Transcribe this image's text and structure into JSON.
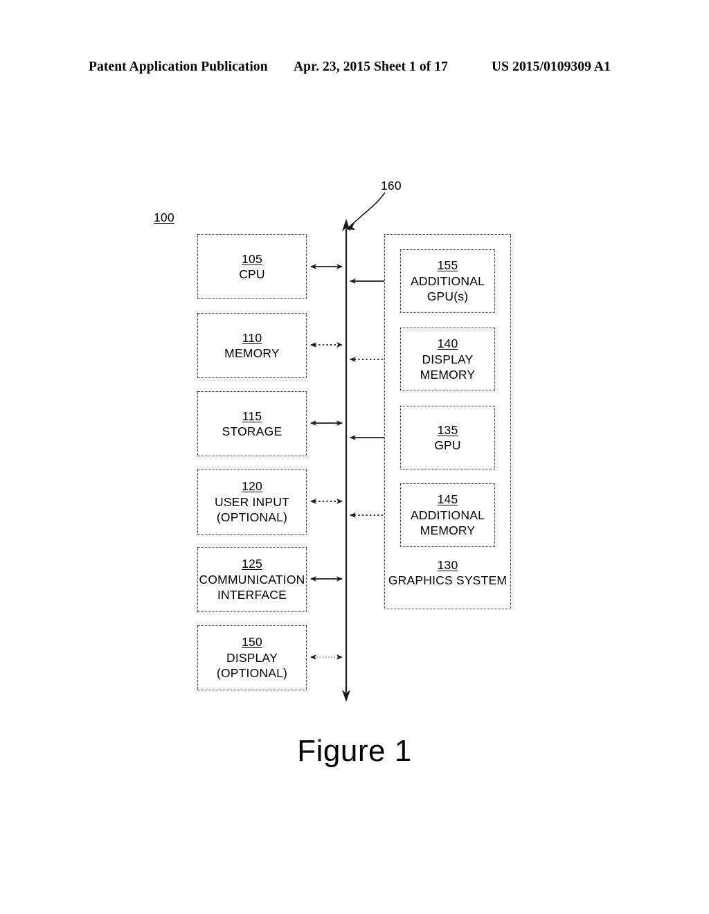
{
  "header": {
    "left": "Patent Application Publication",
    "middle": "Apr. 23, 2015  Sheet 1 of 17",
    "right": "US 2015/0109309 A1"
  },
  "figure": {
    "caption": "Figure 1",
    "system_ref": "100",
    "bus_ref": "160"
  },
  "left_column": [
    {
      "ref": "105",
      "label": "CPU",
      "link": "solid"
    },
    {
      "ref": "110",
      "label": "MEMORY",
      "link": "dotted"
    },
    {
      "ref": "115",
      "label": "STORAGE",
      "link": "solid"
    },
    {
      "ref": "120",
      "label": "USER INPUT\n(OPTIONAL)",
      "link": "dotted"
    },
    {
      "ref": "125",
      "label": "COMMUNICATION\nINTERFACE",
      "link": "solid"
    },
    {
      "ref": "150",
      "label": "DISPLAY\n(OPTIONAL)",
      "link": "faint"
    }
  ],
  "graphics_system": {
    "ref": "130",
    "label": "GRAPHICS SYSTEM",
    "blocks": [
      {
        "ref": "155",
        "label": "ADDITIONAL\nGPU(s)",
        "link": "solid"
      },
      {
        "ref": "140",
        "label": "DISPLAY\nMEMORY",
        "link": "dotted"
      },
      {
        "ref": "135",
        "label": "GPU",
        "link": "solid"
      },
      {
        "ref": "145",
        "label": "ADDITIONAL\nMEMORY",
        "link": "dotted"
      }
    ]
  },
  "colors": {
    "ink": "#1b1b1b",
    "paper": "#ffffff"
  }
}
